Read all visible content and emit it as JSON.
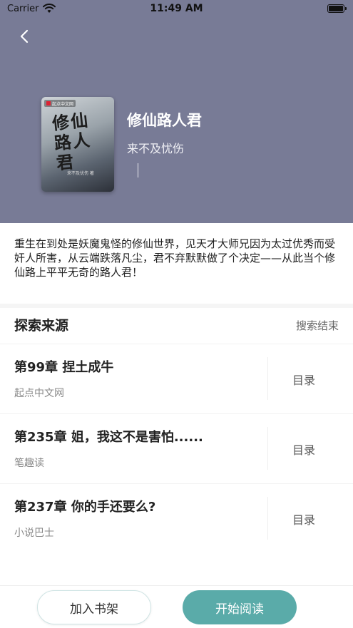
{
  "status_bar": {
    "carrier": "Carrier",
    "time": "11:49 AM"
  },
  "book": {
    "title": "修仙路人君",
    "author": "来不及忧伤",
    "cover_title": "修仙路人君",
    "cover_badge": "起点中文网",
    "cover_author": "来不及忧伤 著",
    "description": "重生在到处是妖魔鬼怪的修仙世界，见天才大师兄因为太过优秀而受奸人所害，从云端跌落凡尘，君不弃默默做了个决定——从此当个修仙路上平平无奇的路人君！"
  },
  "sources": {
    "title": "探索来源",
    "search_end_label": "搜索结束",
    "items": [
      {
        "chapter": "第99章 捏土成牛",
        "site": "起点中文网",
        "toc_label": "目录"
      },
      {
        "chapter": "第235章 姐，我这不是害怕......",
        "site": "笔趣读",
        "toc_label": "目录"
      },
      {
        "chapter": "第237章 你的手还要么?",
        "site": "小说巴士",
        "toc_label": "目录"
      }
    ]
  },
  "actions": {
    "add_shelf_label": "加入书架",
    "start_read_label": "开始阅读"
  },
  "colors": {
    "header_bg": "#787b96",
    "accent": "#5aaba9"
  }
}
